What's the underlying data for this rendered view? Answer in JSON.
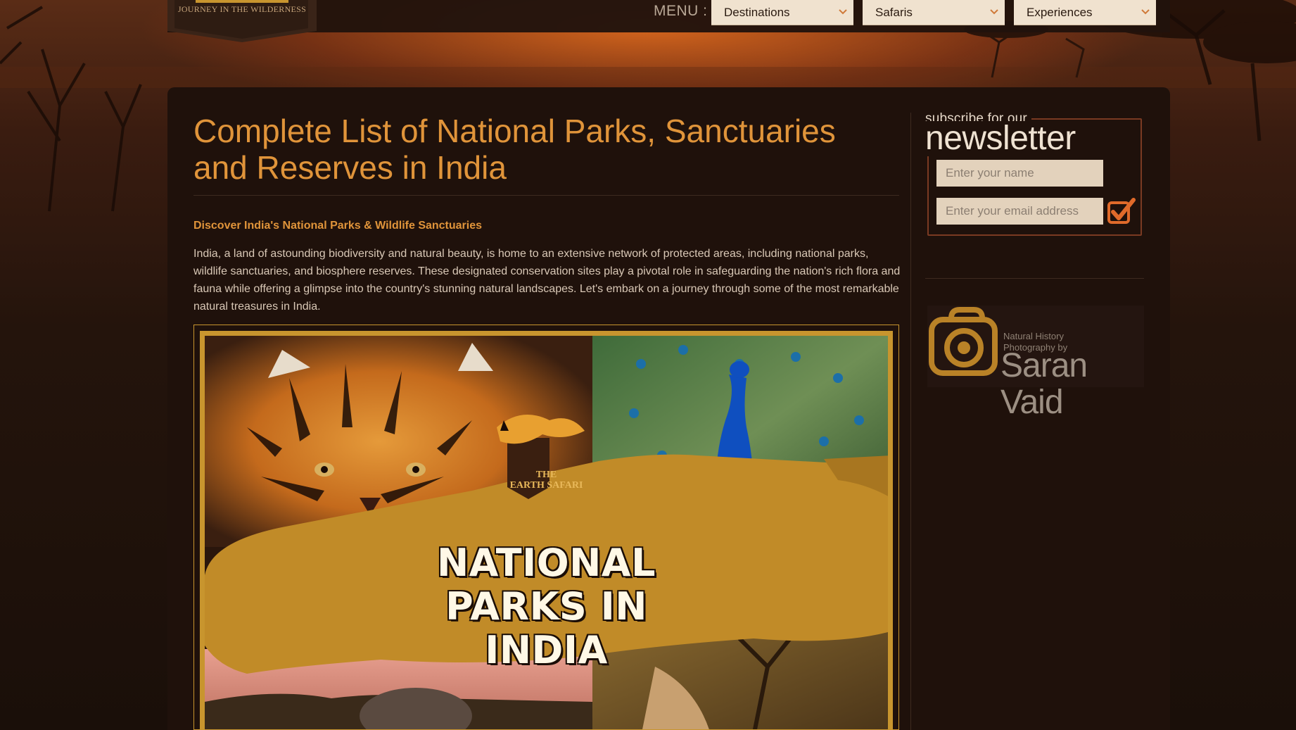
{
  "header": {
    "logo_tagline": "JOURNEY IN THE WILDERNESS",
    "menu_label": "MENU :",
    "dropdowns": [
      {
        "label": "Destinations"
      },
      {
        "label": "Safaris"
      },
      {
        "label": "Experiences"
      }
    ]
  },
  "article": {
    "title": "Complete List of National Parks, Sanctuaries and Reserves in India",
    "subheading": "Discover India's National Parks & Wildlife Sanctuaries",
    "intro": "India, a land of astounding biodiversity and natural beauty, is home to an extensive network of protected areas, including national parks, wildlife sanctuaries, and biosphere reserves. These designated conservation sites play a pivotal role in safeguarding the nation's rich flora and fauna while offering a glimpse into the country's stunning natural landscapes. Let's embark on a journey through some of the most remarkable natural treasures in India.",
    "hero": {
      "logo_line1": "THE",
      "logo_line2": "EARTH SAFARI",
      "headline": "NATIONAL PARKS IN INDIA"
    }
  },
  "sidebar": {
    "newsletter": {
      "small_text": "subscribe for our",
      "big_text": "newsletter",
      "name_placeholder": "Enter your name",
      "email_placeholder": "Enter your email address",
      "submit_icon": "check-icon"
    },
    "photo_banner": {
      "small_text": "Natural History Photography by",
      "name": "Saran Vaid",
      "icon": "camera-icon"
    }
  },
  "colors": {
    "accent": "#e0943a",
    "gold": "#c8952e",
    "panel": "#1f110b"
  }
}
